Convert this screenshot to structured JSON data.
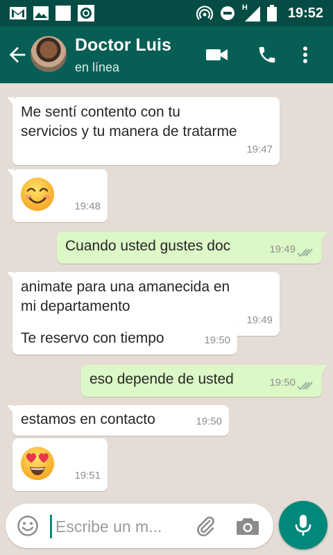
{
  "status_bar": {
    "time": "19:52",
    "network_label": "H",
    "left_icons": [
      "gmail-icon",
      "gallery-icon",
      "blank-notification-icon",
      "target-icon"
    ],
    "right_icons": [
      "hotspot-icon",
      "do-not-disturb-icon",
      "signal-icon",
      "battery-icon"
    ]
  },
  "header": {
    "contact_name": "Doctor Luis",
    "contact_status": "en línea",
    "icons": [
      "back-arrow-icon",
      "video-call-icon",
      "phone-icon",
      "more-vert-icon"
    ]
  },
  "colors": {
    "header_bg": "#075e54",
    "status_bg": "#054d44",
    "chat_bg": "#e5ddd5",
    "incoming_bubble": "#ffffff",
    "outgoing_bubble": "#dcf8c6",
    "accent": "#00897b"
  },
  "messages": [
    {
      "direction": "in",
      "lines": [
        "Me sentí contento con tu",
        "servicios y tu manera de tratarme"
      ],
      "time": "19:47"
    },
    {
      "direction": "in",
      "emoji": "smiling-face-icon",
      "time": "19:48"
    },
    {
      "direction": "out",
      "lines": [
        "Cuando usted gustes doc"
      ],
      "time": "19:49",
      "status": "read"
    },
    {
      "direction": "in",
      "lines": [
        "animate para una amanecida en",
        "mi departamento"
      ],
      "time": "19:49"
    },
    {
      "direction": "in",
      "lines": [
        "Te reservo con tiempo"
      ],
      "time": "19:50"
    },
    {
      "direction": "out",
      "lines": [
        "eso depende de usted"
      ],
      "time": "19:50",
      "status": "read"
    },
    {
      "direction": "in",
      "lines": [
        "estamos en contacto"
      ],
      "time": "19:50"
    },
    {
      "direction": "in",
      "emoji": "heart-eyes-face-icon",
      "time": "19:51"
    }
  ],
  "composer": {
    "placeholder": "Escribe un m...",
    "value": "",
    "icons": [
      "emoji-icon",
      "attach-icon",
      "camera-icon",
      "mic-icon"
    ]
  }
}
